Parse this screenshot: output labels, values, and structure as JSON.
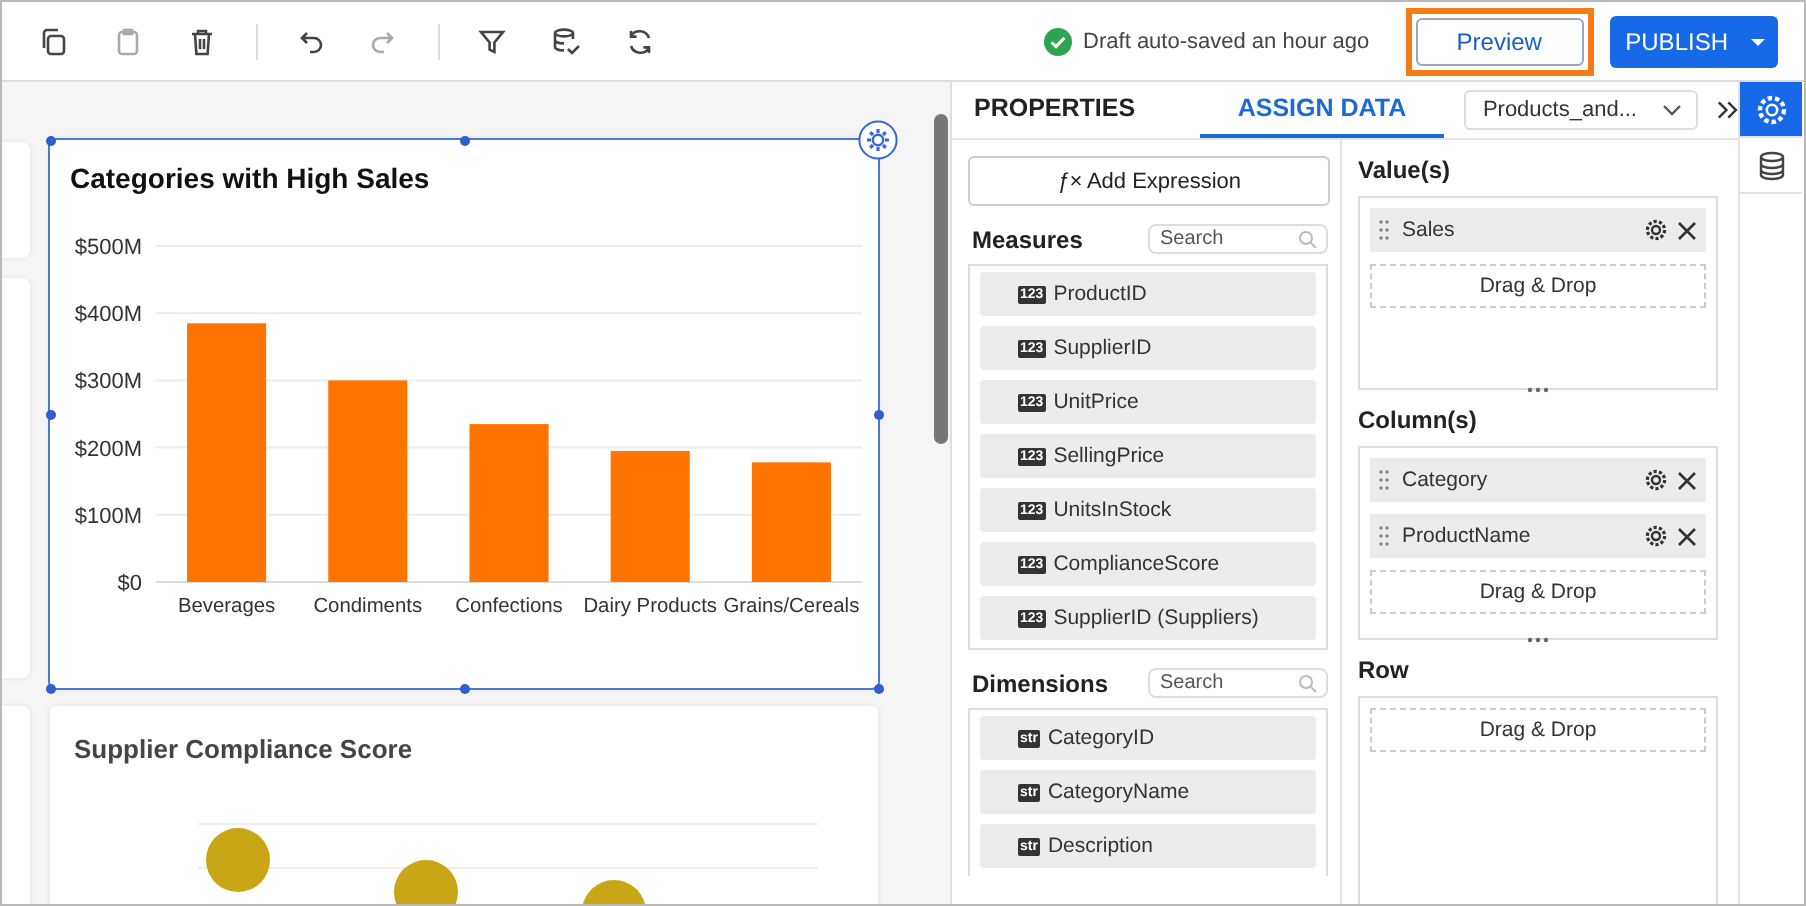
{
  "toolbar": {
    "tools": [
      {
        "kind": "copy",
        "disabled": false
      },
      {
        "kind": "paste",
        "disabled": true
      },
      {
        "kind": "delete",
        "disabled": false
      },
      {
        "kind": "undo",
        "disabled": false
      },
      {
        "kind": "redo",
        "disabled": true
      },
      {
        "kind": "filter",
        "disabled": false
      },
      {
        "kind": "data-check",
        "disabled": false
      },
      {
        "kind": "refresh",
        "disabled": false
      }
    ],
    "status": "Draft auto-saved an hour ago",
    "preview": {
      "label": "Preview",
      "highlighted": true
    },
    "publish": {
      "label": "PUBLISH"
    }
  },
  "canvas": {
    "widgets": [
      {
        "kind": "chart",
        "selected": true,
        "chart_data": {
          "type": "bar",
          "title": "Categories with High Sales",
          "categories": [
            "Beverages",
            "Condiments",
            "Confections",
            "Dairy Products",
            "Grains/Cereals"
          ],
          "grid": true,
          "series": [
            {
              "color": "#ff7300",
              "values": [
                385,
                300,
                235,
                195,
                178
              ]
            }
          ],
          "ylim": [
            0,
            500
          ],
          "yticks": [
            {
              "value": 0,
              "label": "$0"
            },
            {
              "value": 100,
              "label": "$100M"
            },
            {
              "value": 200,
              "label": "$200M"
            },
            {
              "value": 300,
              "label": "$300M"
            },
            {
              "value": 400,
              "label": "$400M"
            },
            {
              "value": 500,
              "label": "$500M"
            }
          ]
        }
      },
      {
        "kind": "scatter-preview",
        "title": "Supplier Compliance Score"
      }
    ]
  },
  "panel": {
    "tabs": [
      {
        "label": "PROPERTIES",
        "selected": false
      },
      {
        "label": "ASSIGN DATA",
        "selected": true
      }
    ],
    "datasource": "Products_and...",
    "add_expression": {
      "icon": "ƒ×",
      "label": "Add Expression"
    },
    "sections": [
      {
        "title": "Measures",
        "placeholder": "Search",
        "fields": [
          {
            "badge": "123",
            "name": "ProductID"
          },
          {
            "badge": "123",
            "name": "SupplierID"
          },
          {
            "badge": "123",
            "name": "UnitPrice"
          },
          {
            "badge": "123",
            "name": "SellingPrice"
          },
          {
            "badge": "123",
            "name": "UnitsInStock"
          },
          {
            "badge": "123",
            "name": "ComplianceScore"
          },
          {
            "badge": "123",
            "name": "SupplierID (Suppliers)"
          }
        ]
      },
      {
        "title": "Dimensions",
        "placeholder": "Search",
        "fields": [
          {
            "badge": "str",
            "name": "CategoryID"
          },
          {
            "badge": "str",
            "name": "CategoryName"
          },
          {
            "badge": "str",
            "name": "Description"
          }
        ]
      }
    ],
    "drop_zones": [
      {
        "title": "Value(s)",
        "items": [
          "Sales"
        ],
        "hint": "Drag & Drop",
        "resizable": true
      },
      {
        "title": "Column(s)",
        "items": [
          "Category",
          "ProductName"
        ],
        "hint": "Drag & Drop",
        "resizable": true
      },
      {
        "title": "Row",
        "hint": "Drag & Drop",
        "resizable": false
      }
    ]
  },
  "side_strip": [
    {
      "kind": "settings",
      "selected": true
    },
    {
      "kind": "database",
      "selected": false
    }
  ]
}
